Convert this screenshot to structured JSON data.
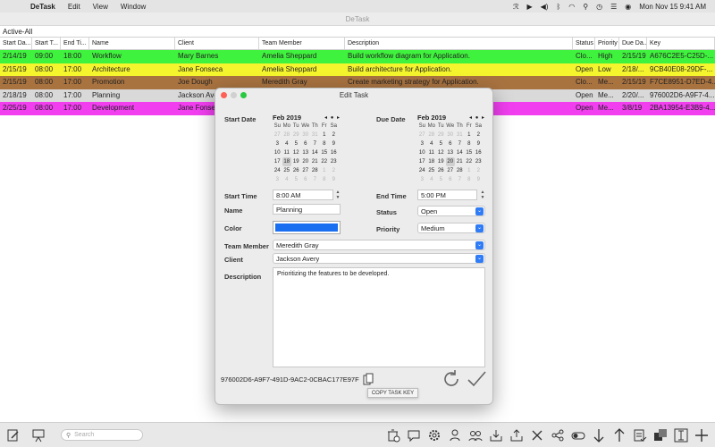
{
  "menubar": {
    "app_name": "DeTask",
    "items": [
      "Edit",
      "View",
      "Window"
    ],
    "datetime": "Mon Nov 15  9:41 AM"
  },
  "window": {
    "title": "DeTask"
  },
  "filter": {
    "label": "Active-All"
  },
  "table": {
    "headers": [
      "Start Da...",
      "Start T...",
      "End Ti...",
      "Name",
      "Client",
      "Team Member",
      "Description",
      "Status",
      "Priority",
      "Due Da...",
      "Key"
    ],
    "rows": [
      {
        "color": "#3ff23d",
        "cells": [
          "2/14/19",
          "09:00",
          "18:00",
          "Workflow",
          "Mary Barnes",
          "Amelia Sheppard",
          "Build workflow diagram for Application.",
          "Clo...",
          "High",
          "2/15/19",
          "A676C2E5-C25D-..."
        ]
      },
      {
        "color": "#f5f52e",
        "cells": [
          "2/15/19",
          "08:00",
          "17:00",
          "Architecture",
          "Jane Fonseca",
          "Amelia Sheppard",
          "Build architecture for Application.",
          "Open",
          "Low",
          "2/18/...",
          "9CB40E08-29DF-..."
        ]
      },
      {
        "color": "#a97340",
        "cells": [
          "2/15/19",
          "08:00",
          "17:00",
          "Promotion",
          "Joe Dough",
          "Meredith Gray",
          "Create marketing strategy for Application.",
          "Clo...",
          "Me...",
          "2/15/19",
          "F7CE8951-D7ED-4..."
        ]
      },
      {
        "color": "#d9d9d9",
        "cells": [
          "2/18/19",
          "08:00",
          "17:00",
          "Planning",
          "Jackson Avery",
          "",
          "",
          "Open",
          "Me...",
          "2/20/...",
          "976002D6-A9F7-4..."
        ]
      },
      {
        "color": "#f13ff0",
        "cells": [
          "2/25/19",
          "08:00",
          "17:00",
          "Development",
          "Jane Fonseca",
          "",
          "",
          "Open",
          "Me...",
          "3/8/19",
          "2BA13954-E3B9-4..."
        ]
      }
    ]
  },
  "dialog": {
    "title": "Edit Task",
    "start_date_label": "Start Date",
    "due_date_label": "Due Date",
    "start_cal": {
      "month": "Feb 2019",
      "nav": "◂ ● ▸",
      "dow": [
        "Su",
        "Mo",
        "Tu",
        "We",
        "Th",
        "Fr",
        "Sa"
      ],
      "days": [
        "27",
        "28",
        "29",
        "30",
        "31",
        "1",
        "2",
        "3",
        "4",
        "5",
        "6",
        "7",
        "8",
        "9",
        "10",
        "11",
        "12",
        "13",
        "14",
        "15",
        "16",
        "17",
        "18",
        "19",
        "20",
        "21",
        "22",
        "23",
        "24",
        "25",
        "26",
        "27",
        "28",
        "1",
        "2",
        "3",
        "4",
        "5",
        "6",
        "7",
        "8",
        "9"
      ],
      "selected": "18"
    },
    "due_cal": {
      "month": "Feb 2019",
      "nav": "◂ ● ▸",
      "dow": [
        "Su",
        "Mo",
        "Tu",
        "We",
        "Th",
        "Fr",
        "Sa"
      ],
      "days": [
        "27",
        "28",
        "29",
        "30",
        "31",
        "1",
        "2",
        "3",
        "4",
        "5",
        "6",
        "7",
        "8",
        "9",
        "10",
        "11",
        "12",
        "13",
        "14",
        "15",
        "16",
        "17",
        "18",
        "19",
        "20",
        "21",
        "22",
        "23",
        "24",
        "25",
        "26",
        "27",
        "28",
        "1",
        "2",
        "3",
        "4",
        "5",
        "6",
        "7",
        "8",
        "9"
      ],
      "selected": "20"
    },
    "start_time_label": "Start Time",
    "start_time_value": "8:00 AM",
    "end_time_label": "End Time",
    "end_time_value": "5:00 PM",
    "name_label": "Name",
    "name_value": "Planning",
    "status_label": "Status",
    "status_value": "Open",
    "color_label": "Color",
    "color_value": "#1a6ff0",
    "priority_label": "Priority",
    "priority_value": "Medium",
    "team_member_label": "Team Member",
    "team_member_value": "Meredith Gray",
    "client_label": "Client",
    "client_value": "Jackson Avery",
    "description_label": "Description",
    "description_value": "Prioritizing the features to be developed.",
    "task_key": "976002D6-A9F7-491D-9AC2-0CBAC177E97F",
    "tooltip": "COPY TASK KEY"
  },
  "search": {
    "placeholder": "Search"
  }
}
